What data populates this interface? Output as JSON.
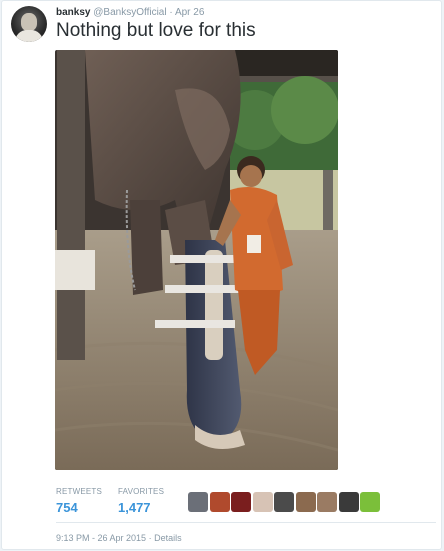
{
  "tweet": {
    "user": {
      "name": "banksy",
      "handle": "@BanksyOfficial",
      "separator": "·",
      "date": "Apr 26"
    },
    "text": "Nothing but love for this",
    "stats": [
      {
        "label": "RETWEETS",
        "value": "754"
      },
      {
        "label": "FAVORITES",
        "value": "1,477"
      }
    ],
    "favoriters": [
      {
        "icon": "favoriter-avatar",
        "color": "#6b6f78"
      },
      {
        "icon": "favoriter-avatar",
        "color": "#b04a2d"
      },
      {
        "icon": "favoriter-avatar",
        "color": "#7a1e1e"
      },
      {
        "icon": "favoriter-avatar",
        "color": "#d7c3b5"
      },
      {
        "icon": "favoriter-avatar",
        "color": "#4b4b4b"
      },
      {
        "icon": "favoriter-avatar",
        "color": "#8b6a4f"
      },
      {
        "icon": "favoriter-avatar",
        "color": "#9a7b63"
      },
      {
        "icon": "favoriter-avatar",
        "color": "#3a3a3a"
      },
      {
        "icon": "favoriter-avatar",
        "color": "#7bbf3a"
      }
    ],
    "meta": {
      "time": "9:13 PM - 26 Apr 2015",
      "separator": "·",
      "details": "Details"
    }
  },
  "colors": {
    "link_blue": "#3b94d9",
    "muted_gray": "#8899a6",
    "text_dark": "#292f33"
  }
}
